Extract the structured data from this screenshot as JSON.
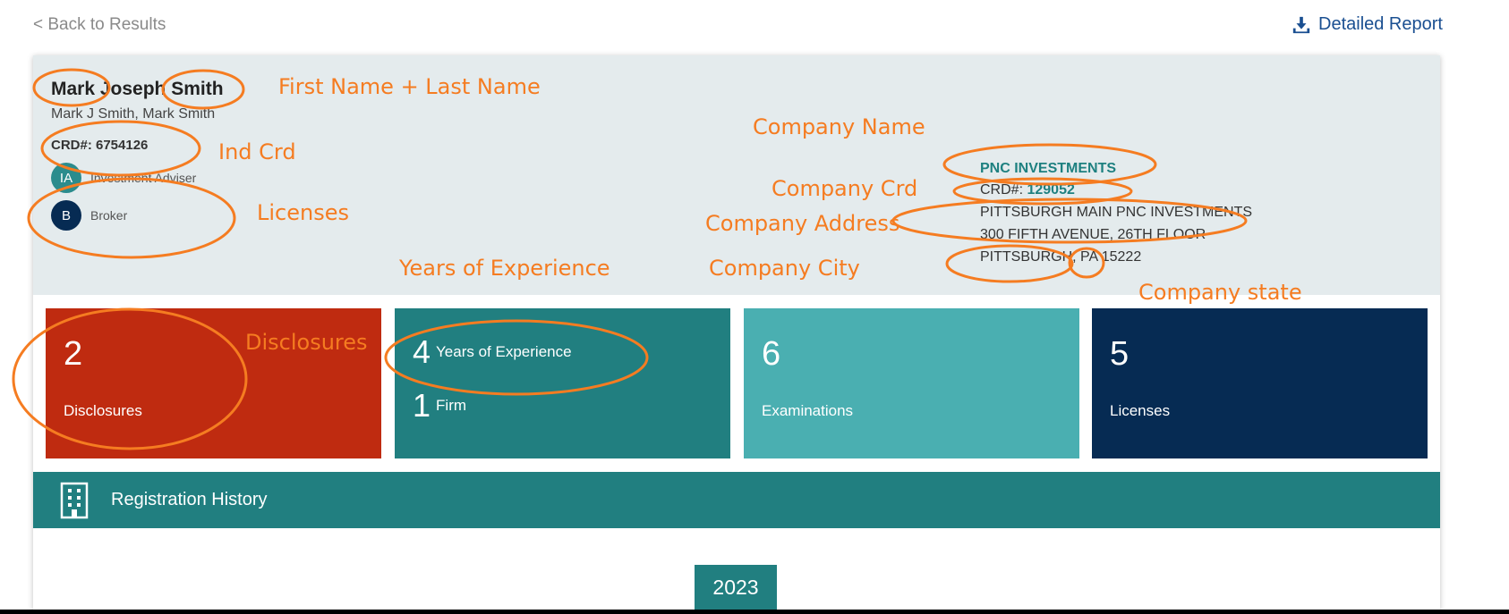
{
  "nav": {
    "back_label": "< Back to Results",
    "report_label": "Detailed Report"
  },
  "individual": {
    "full_name": "Mark Joseph Smith",
    "other_names": "Mark J Smith, Mark Smith",
    "crd": "CRD#: 6754126",
    "licenses": [
      {
        "code": "IA",
        "label": "Investment Adviser",
        "color": "#2b8c8d"
      },
      {
        "code": "B",
        "label": "Broker",
        "color": "#062b53"
      }
    ]
  },
  "firm": {
    "name": "PNC INVESTMENTS",
    "crd_prefix": "CRD#:",
    "crd_number": "129052",
    "address_1": "PITTSBURGH MAIN PNC INVESTMENTS",
    "address_2": "300 FIFTH AVENUE, 26TH FLOOR",
    "city_state_zip": "PITTSBURGH, PA 15222"
  },
  "stats": {
    "disclosures": {
      "value": "2",
      "label": "Disclosures"
    },
    "experience": {
      "years": "4",
      "years_label": "Years of Experience",
      "firms": "1",
      "firms_label": "Firm"
    },
    "examinations": {
      "value": "6",
      "label": "Examinations"
    },
    "licenses": {
      "value": "5",
      "label": "Licenses"
    }
  },
  "registration": {
    "title": "Registration History",
    "year": "2023"
  },
  "annotations": {
    "names": "First Name + Last Name",
    "ind_crd": "Ind Crd",
    "licenses": "Licenses",
    "years": "Years of Experience",
    "disclosures": "Disclosures",
    "company_name": "Company Name",
    "company_crd": "Company Crd",
    "company_address": "Company Address",
    "company_city": "Company City",
    "company_state": "Company state"
  },
  "colors": {
    "accent_teal": "#217f80",
    "annotation_orange": "#f57c21",
    "disclosure_red": "#bf2b10",
    "navy": "#062b53"
  }
}
